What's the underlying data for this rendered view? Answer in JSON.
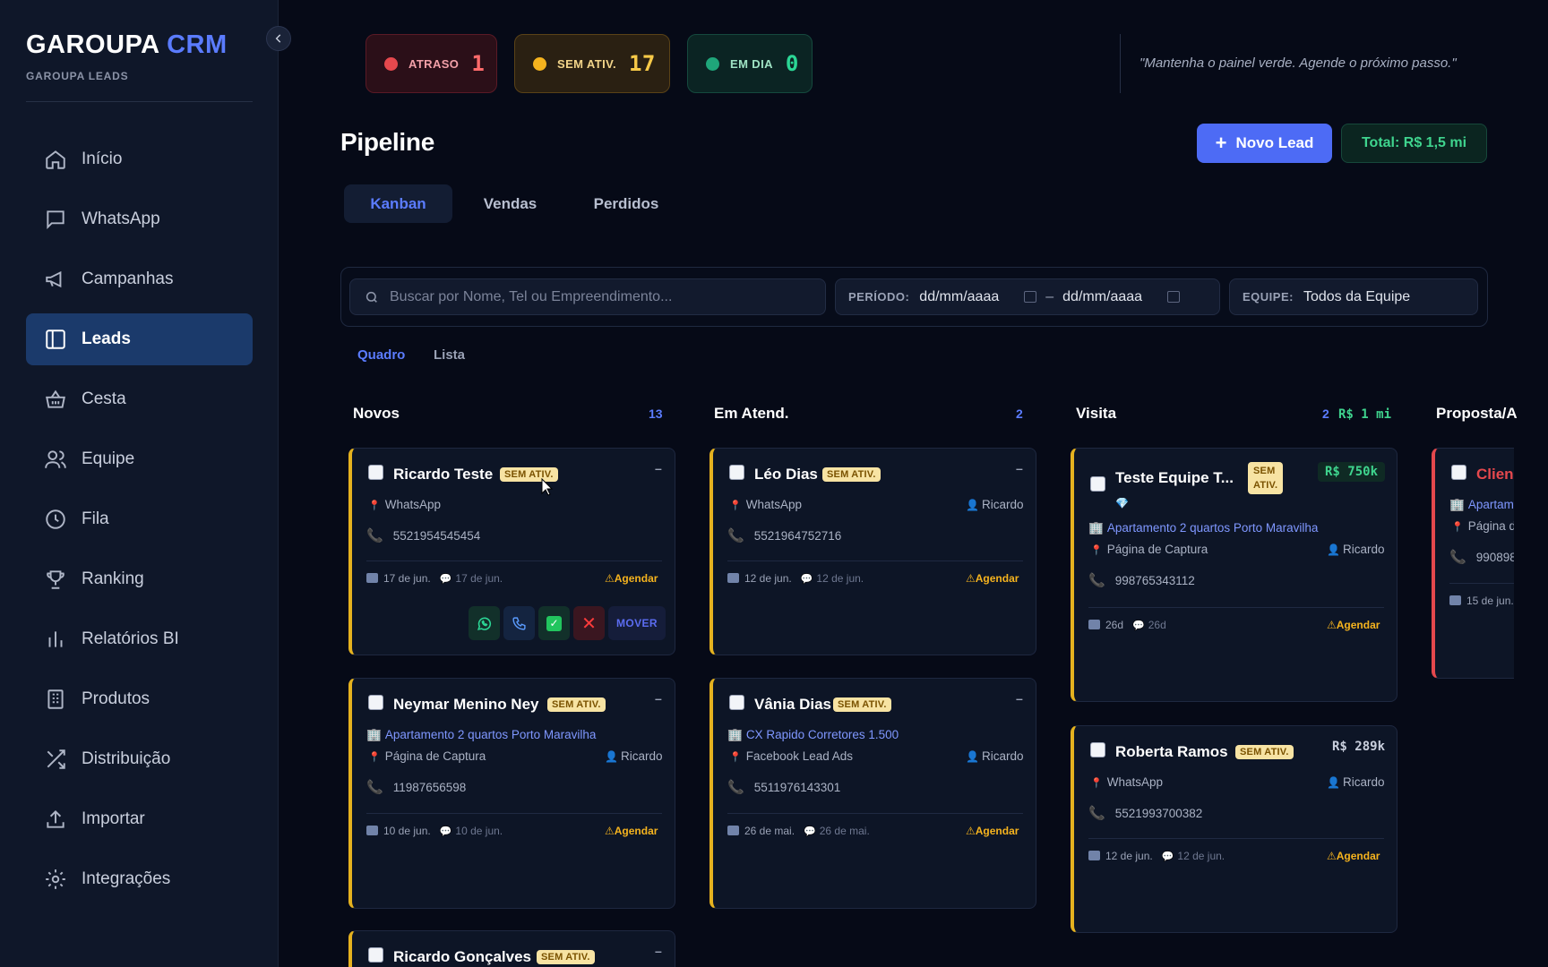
{
  "sidebar": {
    "brand_name": "GAROUPA",
    "brand_accent": "CRM",
    "brand_sub": "GAROUPA LEADS",
    "items": [
      {
        "label": "Início",
        "icon": "home-icon"
      },
      {
        "label": "WhatsApp",
        "icon": "chat-icon"
      },
      {
        "label": "Campanhas",
        "icon": "megaphone-icon"
      },
      {
        "label": "Leads",
        "icon": "board-icon",
        "active": true
      },
      {
        "label": "Cesta",
        "icon": "basket-icon"
      },
      {
        "label": "Equipe",
        "icon": "users-icon"
      },
      {
        "label": "Fila",
        "icon": "clock-icon"
      },
      {
        "label": "Ranking",
        "icon": "trophy-icon"
      },
      {
        "label": "Relatórios BI",
        "icon": "bar-chart-icon"
      },
      {
        "label": "Produtos",
        "icon": "building-icon"
      },
      {
        "label": "Distribuição",
        "icon": "shuffle-icon"
      },
      {
        "label": "Importar",
        "icon": "upload-icon"
      },
      {
        "label": "Integrações",
        "icon": "gear-icon"
      }
    ]
  },
  "status": {
    "late_label": "ATRASO",
    "late_count": "1",
    "noact_label": "SEM ATIV.",
    "noact_count": "17",
    "ok_label": "EM DIA",
    "ok_count": "0"
  },
  "quote": "\"Mantenha o painel verde. Agende o próximo passo.\"",
  "header": {
    "title": "Pipeline",
    "new_lead_label": "Novo Lead",
    "total_label": "Total: R$ 1,5 mi"
  },
  "tabs": [
    "Kanban",
    "Vendas",
    "Perdidos"
  ],
  "filters": {
    "search_placeholder": "Buscar por Nome, Tel ou Empreendimento...",
    "period_label": "PERÍODO:",
    "date_from": "dd/mm/aaaa",
    "date_sep": "–",
    "date_to": "dd/mm/aaaa",
    "team_label": "EQUIPE:",
    "team_value": "Todos da Equipe"
  },
  "views": [
    "Quadro",
    "Lista"
  ],
  "columns": [
    {
      "title": "Novos",
      "count": "13"
    },
    {
      "title": "Em Atend.",
      "count": "2"
    },
    {
      "title": "Visita",
      "count": "2",
      "value": "R$ 1 mi"
    },
    {
      "title": "Proposta/A"
    }
  ],
  "badge_text": "SEM ATIV.",
  "badge_line1": "SEM",
  "badge_line2": "ATIV.",
  "agendar": "Agendar",
  "mover": "MOVER",
  "cards": {
    "c1": {
      "name": "Ricardo Teste",
      "source": "WhatsApp",
      "phone": "5521954545454",
      "date1": "17 de jun.",
      "date2": "17 de jun."
    },
    "c2": {
      "name": "Neymar Menino Ney",
      "project": "Apartamento 2 quartos Porto Maravilha",
      "source": "Página de Captura",
      "owner": "Ricardo",
      "phone": "11987656598",
      "date1": "10 de jun.",
      "date2": "10 de jun."
    },
    "c3": {
      "name": "Ricardo Gonçalves"
    },
    "c4": {
      "name": "Léo Dias",
      "source": "WhatsApp",
      "owner": "Ricardo",
      "phone": "5521964752716",
      "date1": "12 de jun.",
      "date2": "12 de jun."
    },
    "c5": {
      "name": "Vânia Dias",
      "project": "CX Rapido Corretores 1.500",
      "source": "Facebook Lead Ads",
      "owner": "Ricardo",
      "phone": "5511976143301",
      "date1": "26 de mai.",
      "date2": "26 de mai."
    },
    "c6": {
      "name": "Teste Equipe T...",
      "value": "R$ 750k",
      "project": "Apartamento 2 quartos Porto Maravilha",
      "source": "Página de Captura",
      "owner": "Ricardo",
      "phone": "998765343112",
      "date1": "26d",
      "date2": "26d"
    },
    "c7": {
      "name": "Roberta Ramos",
      "value": "R$ 289k",
      "source": "WhatsApp",
      "owner": "Ricardo",
      "phone": "5521993700382",
      "date1": "12 de jun.",
      "date2": "12 de jun."
    },
    "c8": {
      "name": "Clien",
      "project": "Apartam",
      "source": "Página d",
      "phone": "990898",
      "date1": "15 de jun."
    }
  }
}
